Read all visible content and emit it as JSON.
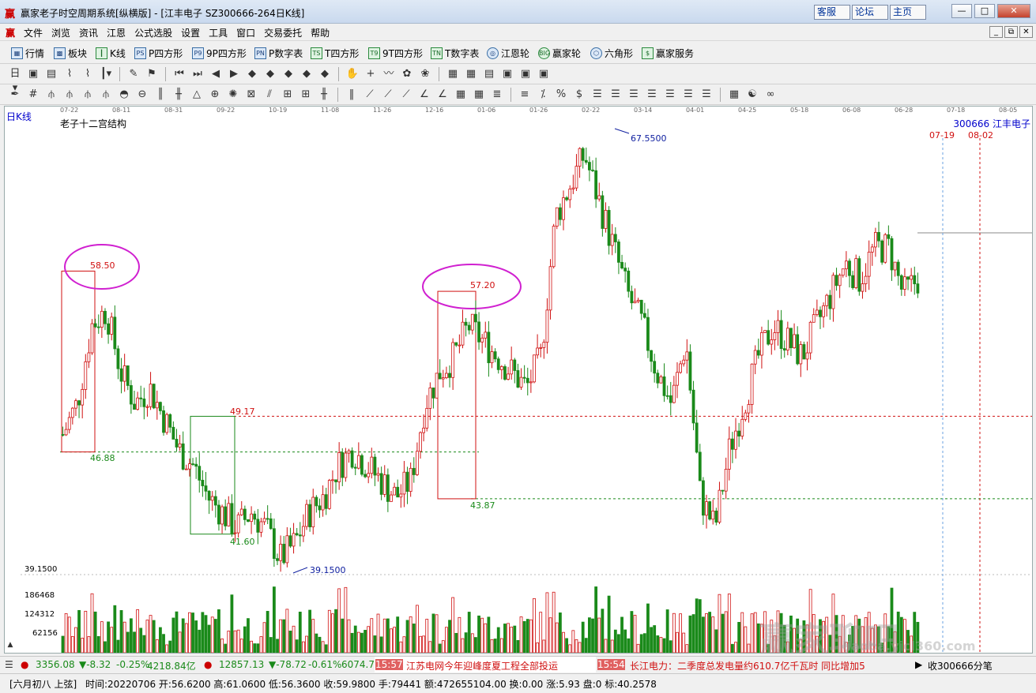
{
  "window": {
    "title": "赢家老子时空周期系统[纵横版] - [江丰电子  SZ300666-264日K线]",
    "top_links": [
      "客服",
      "论坛",
      "主页"
    ],
    "controls": [
      "—",
      "□",
      "✕"
    ]
  },
  "menu": {
    "logo": "赢",
    "items": [
      "文件",
      "浏览",
      "资讯",
      "江恩",
      "公式选股",
      "设置",
      "工具",
      "窗口",
      "交易委托",
      "帮助"
    ],
    "mdi_controls": [
      "_",
      "⧉",
      "✕"
    ]
  },
  "toolbar": {
    "buttons": [
      {
        "label": "行情",
        "icon": "grid-icon"
      },
      {
        "label": "板块",
        "icon": "blocks-icon"
      },
      {
        "label": "K线",
        "icon": "candle-icon"
      },
      {
        "label": "P四方形",
        "icon": "ps-icon",
        "tag": "PS"
      },
      {
        "label": "9P四方形",
        "icon": "p9-icon",
        "tag": "P9"
      },
      {
        "label": "P数字表",
        "icon": "pn-icon",
        "tag": "PN"
      },
      {
        "label": "T四方形",
        "icon": "ts-icon",
        "tag": "TS"
      },
      {
        "label": "9T四方形",
        "icon": "t9-icon",
        "tag": "T9"
      },
      {
        "label": "T数字表",
        "icon": "tn-icon",
        "tag": "TN"
      },
      {
        "label": "江恩轮",
        "icon": "gann-wheel-icon"
      },
      {
        "label": "赢家轮",
        "icon": "winner-wheel-icon",
        "tag": "BIG"
      },
      {
        "label": "六角形",
        "icon": "hexagon-icon"
      },
      {
        "label": "赢家服务",
        "icon": "dollar-icon",
        "tag": "$"
      }
    ]
  },
  "chart": {
    "tab_label": "日K线",
    "study_title": "老子十二宫结构",
    "code_label": "300666  江丰电子",
    "time_labels": [
      "07-19",
      "08-02"
    ],
    "date_axis": [
      "07-22",
      "08-11",
      "08-31",
      "09-22",
      "10-19",
      "11-08",
      "11-26",
      "12-16",
      "01-06",
      "01-26",
      "02-22",
      "03-14",
      "04-01",
      "04-25",
      "05-18",
      "06-08",
      "06-28",
      "07-18",
      "08-05"
    ],
    "annotations": {
      "high_a": "58.50",
      "low_a": "46.88",
      "level_b": "49.17",
      "low_b": "41.60",
      "high_c": "57.20",
      "low_c": "43.87",
      "peak": "67.5500",
      "trough": "39.1500"
    },
    "price_axis_label": "39.1500",
    "volume_axis": [
      "186468",
      "124312",
      "62156"
    ]
  },
  "chart_data": {
    "type": "candlestick",
    "title": "老子十二宫结构",
    "x_axis": [
      "07-22",
      "08-11",
      "08-31",
      "09-22",
      "10-19",
      "11-08",
      "11-26",
      "12-16",
      "01-06",
      "01-26",
      "02-22",
      "03-14",
      "04-01",
      "04-25",
      "05-18",
      "06-08",
      "06-28",
      "07-18",
      "08-05"
    ],
    "ylim": [
      39.15,
      67.55
    ],
    "marked_levels": [
      58.5,
      46.88,
      49.17,
      41.6,
      57.2,
      43.87,
      67.55,
      39.15
    ],
    "close_series_approx": [
      48,
      50,
      55,
      56,
      52,
      50,
      51,
      49,
      47,
      46,
      44,
      43,
      42,
      43,
      42,
      40,
      41,
      43,
      44,
      46,
      47,
      46,
      45,
      44,
      45,
      50,
      52,
      53,
      55,
      54,
      53,
      52,
      51,
      53,
      62,
      64,
      66,
      63,
      60,
      57,
      55,
      52,
      50,
      54,
      44,
      42,
      47,
      50,
      53,
      55,
      54,
      53,
      55,
      57,
      59,
      58,
      60,
      60,
      57,
      58
    ],
    "volume_axis_ticks": [
      186468,
      124312,
      62156
    ]
  },
  "status": {
    "sh_index": "3356.08",
    "sh_change": "▼-8.32",
    "sh_pct": "-0.25%",
    "sh_amount": "4218.84亿",
    "sz_index": "12857.13",
    "sz_change": "▼-78.72",
    "sz_pct": "-0.61%",
    "sz_amount": "6074.79",
    "news1_time": "15:57",
    "news1_text": "江苏电网今年迎峰度夏工程全部投运",
    "news2_time": "15:54",
    "news2_text": "长江电力：二季度总发电量约610.7亿千瓦时 同比增加5",
    "right_label": "收300666分笔"
  },
  "bottom": {
    "lunar": "[六月初八  上弦]",
    "info": "时间:20220706 开:56.6200 高:61.0600 低:56.3600 收:59.9800 手:79441 额:472655104.00 换:0.00 涨:5.93 盘:0 标:40.2578"
  },
  "watermark": {
    "main": "赢家聊吧",
    "url": "liaoba.yjcl360.com"
  },
  "colors": {
    "up": "#d01010",
    "down": "#1a8a1a",
    "circle": "#d020d0",
    "accent": "#0000cc"
  }
}
